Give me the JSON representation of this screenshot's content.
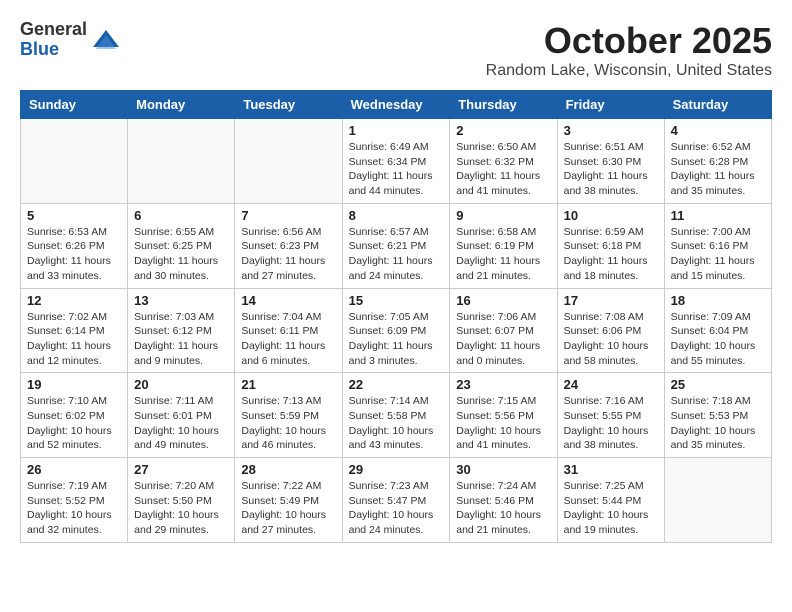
{
  "header": {
    "logo_general": "General",
    "logo_blue": "Blue",
    "month_title": "October 2025",
    "location": "Random Lake, Wisconsin, United States"
  },
  "days_of_week": [
    "Sunday",
    "Monday",
    "Tuesday",
    "Wednesday",
    "Thursday",
    "Friday",
    "Saturday"
  ],
  "weeks": [
    [
      {
        "day": "",
        "info": ""
      },
      {
        "day": "",
        "info": ""
      },
      {
        "day": "",
        "info": ""
      },
      {
        "day": "1",
        "info": "Sunrise: 6:49 AM\nSunset: 6:34 PM\nDaylight: 11 hours\nand 44 minutes."
      },
      {
        "day": "2",
        "info": "Sunrise: 6:50 AM\nSunset: 6:32 PM\nDaylight: 11 hours\nand 41 minutes."
      },
      {
        "day": "3",
        "info": "Sunrise: 6:51 AM\nSunset: 6:30 PM\nDaylight: 11 hours\nand 38 minutes."
      },
      {
        "day": "4",
        "info": "Sunrise: 6:52 AM\nSunset: 6:28 PM\nDaylight: 11 hours\nand 35 minutes."
      }
    ],
    [
      {
        "day": "5",
        "info": "Sunrise: 6:53 AM\nSunset: 6:26 PM\nDaylight: 11 hours\nand 33 minutes."
      },
      {
        "day": "6",
        "info": "Sunrise: 6:55 AM\nSunset: 6:25 PM\nDaylight: 11 hours\nand 30 minutes."
      },
      {
        "day": "7",
        "info": "Sunrise: 6:56 AM\nSunset: 6:23 PM\nDaylight: 11 hours\nand 27 minutes."
      },
      {
        "day": "8",
        "info": "Sunrise: 6:57 AM\nSunset: 6:21 PM\nDaylight: 11 hours\nand 24 minutes."
      },
      {
        "day": "9",
        "info": "Sunrise: 6:58 AM\nSunset: 6:19 PM\nDaylight: 11 hours\nand 21 minutes."
      },
      {
        "day": "10",
        "info": "Sunrise: 6:59 AM\nSunset: 6:18 PM\nDaylight: 11 hours\nand 18 minutes."
      },
      {
        "day": "11",
        "info": "Sunrise: 7:00 AM\nSunset: 6:16 PM\nDaylight: 11 hours\nand 15 minutes."
      }
    ],
    [
      {
        "day": "12",
        "info": "Sunrise: 7:02 AM\nSunset: 6:14 PM\nDaylight: 11 hours\nand 12 minutes."
      },
      {
        "day": "13",
        "info": "Sunrise: 7:03 AM\nSunset: 6:12 PM\nDaylight: 11 hours\nand 9 minutes."
      },
      {
        "day": "14",
        "info": "Sunrise: 7:04 AM\nSunset: 6:11 PM\nDaylight: 11 hours\nand 6 minutes."
      },
      {
        "day": "15",
        "info": "Sunrise: 7:05 AM\nSunset: 6:09 PM\nDaylight: 11 hours\nand 3 minutes."
      },
      {
        "day": "16",
        "info": "Sunrise: 7:06 AM\nSunset: 6:07 PM\nDaylight: 11 hours\nand 0 minutes."
      },
      {
        "day": "17",
        "info": "Sunrise: 7:08 AM\nSunset: 6:06 PM\nDaylight: 10 hours\nand 58 minutes."
      },
      {
        "day": "18",
        "info": "Sunrise: 7:09 AM\nSunset: 6:04 PM\nDaylight: 10 hours\nand 55 minutes."
      }
    ],
    [
      {
        "day": "19",
        "info": "Sunrise: 7:10 AM\nSunset: 6:02 PM\nDaylight: 10 hours\nand 52 minutes."
      },
      {
        "day": "20",
        "info": "Sunrise: 7:11 AM\nSunset: 6:01 PM\nDaylight: 10 hours\nand 49 minutes."
      },
      {
        "day": "21",
        "info": "Sunrise: 7:13 AM\nSunset: 5:59 PM\nDaylight: 10 hours\nand 46 minutes."
      },
      {
        "day": "22",
        "info": "Sunrise: 7:14 AM\nSunset: 5:58 PM\nDaylight: 10 hours\nand 43 minutes."
      },
      {
        "day": "23",
        "info": "Sunrise: 7:15 AM\nSunset: 5:56 PM\nDaylight: 10 hours\nand 41 minutes."
      },
      {
        "day": "24",
        "info": "Sunrise: 7:16 AM\nSunset: 5:55 PM\nDaylight: 10 hours\nand 38 minutes."
      },
      {
        "day": "25",
        "info": "Sunrise: 7:18 AM\nSunset: 5:53 PM\nDaylight: 10 hours\nand 35 minutes."
      }
    ],
    [
      {
        "day": "26",
        "info": "Sunrise: 7:19 AM\nSunset: 5:52 PM\nDaylight: 10 hours\nand 32 minutes."
      },
      {
        "day": "27",
        "info": "Sunrise: 7:20 AM\nSunset: 5:50 PM\nDaylight: 10 hours\nand 29 minutes."
      },
      {
        "day": "28",
        "info": "Sunrise: 7:22 AM\nSunset: 5:49 PM\nDaylight: 10 hours\nand 27 minutes."
      },
      {
        "day": "29",
        "info": "Sunrise: 7:23 AM\nSunset: 5:47 PM\nDaylight: 10 hours\nand 24 minutes."
      },
      {
        "day": "30",
        "info": "Sunrise: 7:24 AM\nSunset: 5:46 PM\nDaylight: 10 hours\nand 21 minutes."
      },
      {
        "day": "31",
        "info": "Sunrise: 7:25 AM\nSunset: 5:44 PM\nDaylight: 10 hours\nand 19 minutes."
      },
      {
        "day": "",
        "info": ""
      }
    ]
  ]
}
